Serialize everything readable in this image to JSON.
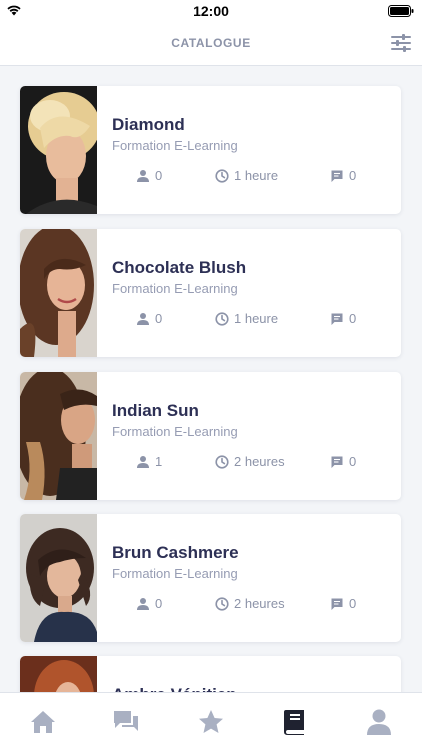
{
  "status_bar": {
    "time": "12:00"
  },
  "header": {
    "title": "CATALOGUE"
  },
  "courses": [
    {
      "name": "Diamond",
      "type": "Formation E-Learning",
      "participants": "0",
      "duration": "1 heure",
      "comments": "0"
    },
    {
      "name": "Chocolate Blush",
      "type": "Formation E-Learning",
      "participants": "0",
      "duration": "1 heure",
      "comments": "0"
    },
    {
      "name": "Indian Sun",
      "type": "Formation E-Learning",
      "participants": "1",
      "duration": "2 heures",
      "comments": "0"
    },
    {
      "name": "Brun Cashmere",
      "type": "Formation E-Learning",
      "participants": "0",
      "duration": "2 heures",
      "comments": "0"
    },
    {
      "name": "Ambre Vénitien",
      "type": "",
      "participants": "",
      "duration": "",
      "comments": ""
    }
  ],
  "tabbar": {
    "items": [
      "home-icon",
      "chat-icon",
      "star-icon",
      "book-icon",
      "profile-icon"
    ],
    "active": "book-icon"
  },
  "colors": {
    "accent": "#2d3055",
    "muted": "#8c93a8",
    "inactive_tab": "#a9b0c2"
  }
}
